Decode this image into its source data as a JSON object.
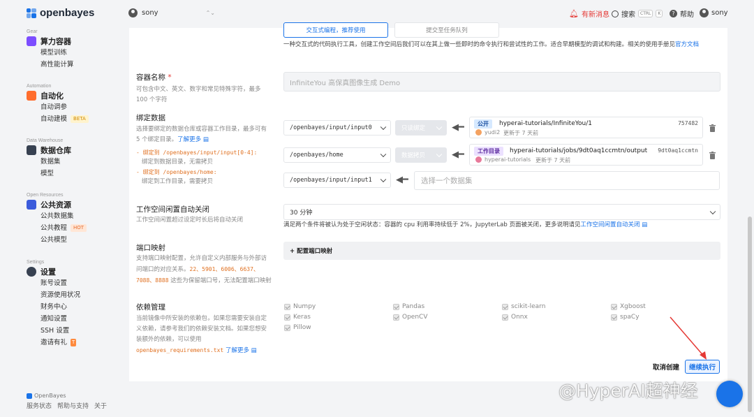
{
  "brand": {
    "name": "openbayes",
    "footer_name": "OpenBayes"
  },
  "topbar": {
    "user": "sony",
    "new_message": "有新消息",
    "search": "搜索",
    "kbd1": "CTRL",
    "kbd2": "K",
    "help": "帮助",
    "account": "sony"
  },
  "sidebar": {
    "sections": [
      {
        "small": "Gear",
        "title": "算力容器",
        "items": [
          "模型训练",
          "高性能计算"
        ]
      },
      {
        "small": "Automation",
        "title": "自动化",
        "items": [
          "自动调参",
          "自动建模"
        ],
        "badge": "BETA"
      },
      {
        "small": "Data Warehouse",
        "title": "数据仓库",
        "items": [
          "数据集",
          "模型"
        ]
      },
      {
        "small": "Open Resources",
        "title": "公共资源",
        "items": [
          "公共数据集",
          "公共教程",
          "公共模型"
        ],
        "badge": "HOT"
      },
      {
        "small": "Settings",
        "title": "设置",
        "items": [
          "账号设置",
          "资源使用状况",
          "财务中心",
          "通知设置",
          "SSH 设置",
          "邀请有礼"
        ]
      }
    ]
  },
  "form": {
    "tab1": "交互式编程，推荐使用",
    "tab2": "提交至任务队列",
    "intro": "一种交互式的代码执行工具，创建工作空间后我们可以在其上做一些即时的命令执行和尝试性的工作。适合早期模型的调试和构建。相关的使用手册见",
    "intro_link": "官方文档",
    "name_label": "容器名称",
    "name_required": "*",
    "name_desc": "可包含中文、英文、数字和常见特殊字符，最多 100 个字符",
    "name_value": "InfiniteYou 高保真图像生成 Demo",
    "bind_label": "绑定数据",
    "bind_desc": "选择要绑定的数据仓库或容器工作目录，最多可有 5 个绑定目录。",
    "bind_more": "了解更多",
    "bind_note1a": "- 绑定到 /openbayes/input/input[0-4]:",
    "bind_note1b": "绑定到数据目录，无需拷贝",
    "bind_note2a": "- 绑定到 /openbayes/home:",
    "bind_note2b": "绑定到工作目录，需要拷贝",
    "bindings": [
      {
        "path": "/openbayes/input/input0",
        "mode": "只读绑定",
        "tag": "公开",
        "repo": "hyperai-tutorials/InfiniteYou/1",
        "id": "757482",
        "user": "yudi2",
        "time": "更新于 7 天前"
      },
      {
        "path": "/openbayes/home",
        "mode": "数据拷贝",
        "tag": "工作目录",
        "repo": "hyperai-tutorials/jobs/9dt0aq1ccmtn/output",
        "id": "9dt0aq1ccmtn",
        "user": "hyperai-tutorials",
        "time": "更新于 7 天前"
      },
      {
        "path": "/openbayes/input/input1",
        "placeholder": "选择一个数据集"
      }
    ],
    "idle_label": "工作空间闲置自动关闭",
    "idle_desc": "工作空间闲置超过设定时长后将自动关闭",
    "idle_value": "30 分钟",
    "idle_note": "满足两个条件将被认为处于空闲状态：容器的 cpu 利用率持续低于 2%，JupyterLab 页面被关闭，更多说明请见",
    "idle_link": "工作空间闲置自动关闭",
    "port_label": "端口映射",
    "port_desc1": "支持端口映射配置，允许自定义内部服务与外部访问端口的对应关系。",
    "port_nums": "22、5901、6006、6637、7088、8888",
    "port_desc2": " 这些为保留端口号，无法配置端口映射",
    "port_button": "+ 配置端口映射",
    "deps_label": "依赖管理",
    "deps_desc": "当前镜像中所安装的依赖包，如果您需要安装自定义依赖，请参考我们的依赖安装文档。如果您想安装额外的依赖，可以使用",
    "deps_file": "openbayes_requirements.txt",
    "deps_more": "了解更多",
    "deps": [
      "Numpy",
      "Pandas",
      "scikit-learn",
      "Xgboost",
      "Keras",
      "OpenCV",
      "Onnx",
      "spaCy",
      "Pillow"
    ],
    "cancel": "取消创建",
    "continue": "继续执行"
  },
  "footer": {
    "links": [
      "服务状态",
      "帮助与支持",
      "关于"
    ]
  },
  "watermark": "@HyperAI超神经",
  "colors": {
    "accent": "#1a73e8",
    "danger": "#e53935",
    "orange": "#e07020",
    "public_tag": "#d6e9ff",
    "work_tag": "#ece1ff"
  }
}
